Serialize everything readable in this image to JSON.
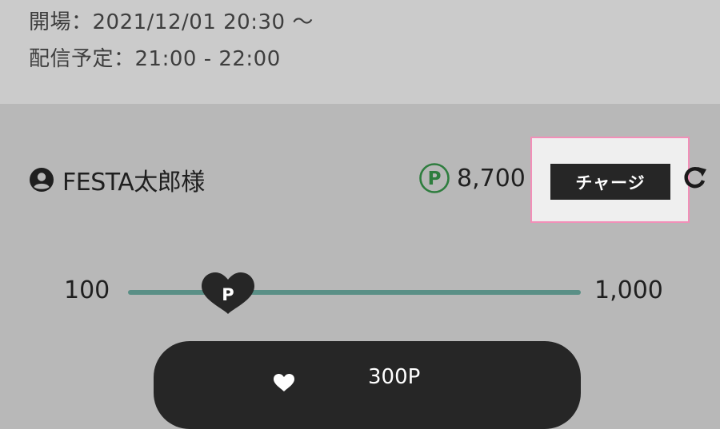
{
  "event": {
    "open_time": "開場：2021/12/01 20:30 ～",
    "stream_schedule": "配信予定：21:00 - 22:00"
  },
  "user": {
    "name": "FESTA太郎様",
    "icon": "user-circle-icon"
  },
  "points": {
    "icon": "point-circle-icon",
    "balance": "8,700",
    "charge_label": "チャージ",
    "refresh_icon": "refresh-icon",
    "accent_color": "#2e7d3e"
  },
  "slider": {
    "min_label": "100",
    "max_label": "1,000",
    "thumb_symbol": "P",
    "track_color": "#5a8f86",
    "current_fraction": 0.22
  },
  "send": {
    "icon": "heart-icon",
    "amount_label": "300P"
  },
  "highlight_color": "#f28fb8"
}
